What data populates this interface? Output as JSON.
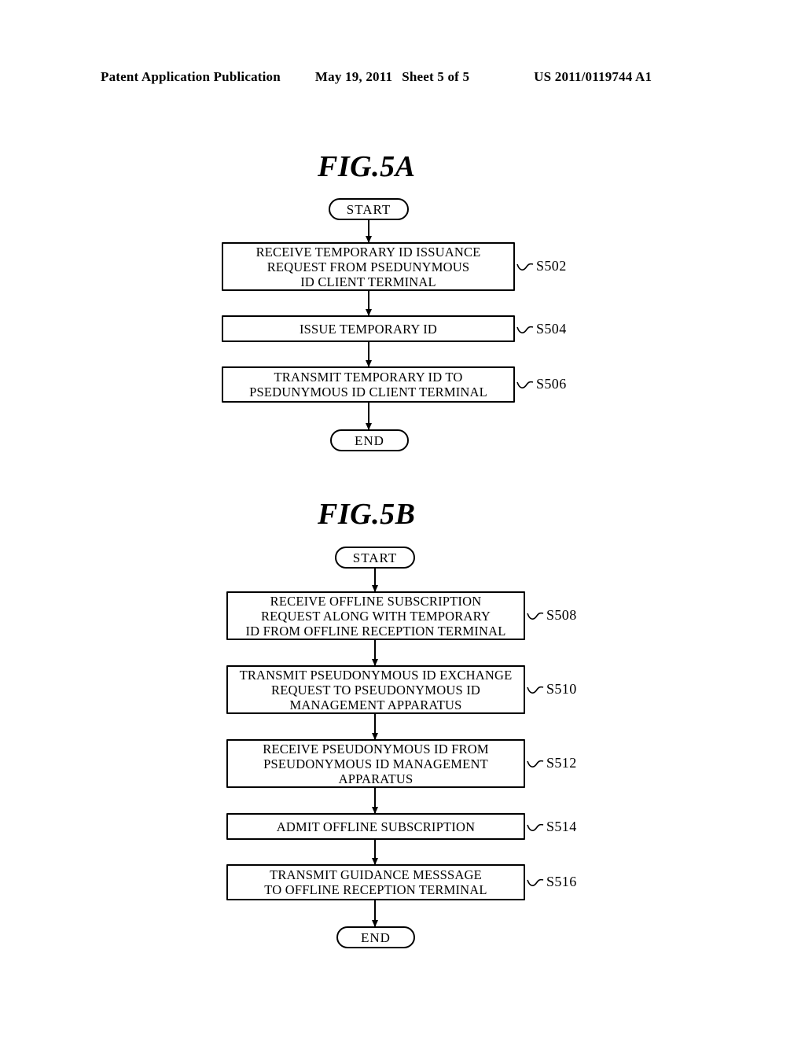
{
  "header": {
    "publication": "Patent Application Publication",
    "date": "May 19, 2011",
    "sheet": "Sheet 5 of 5",
    "publication_number": "US 2011/0119744 A1"
  },
  "figures": [
    {
      "title": "FIG.5A",
      "start_label": "START",
      "end_label": "END",
      "steps": [
        {
          "id": "S502",
          "lines": [
            "RECEIVE TEMPORARY ID ISSUANCE",
            "REQUEST FROM PSEDUNYMOUS",
            "ID CLIENT TERMINAL"
          ]
        },
        {
          "id": "S504",
          "lines": [
            "ISSUE TEMPORARY ID"
          ]
        },
        {
          "id": "S506",
          "lines": [
            "TRANSMIT TEMPORARY ID TO",
            "PSEDUNYMOUS ID CLIENT TERMINAL"
          ]
        }
      ]
    },
    {
      "title": "FIG.5B",
      "start_label": "START",
      "end_label": "END",
      "steps": [
        {
          "id": "S508",
          "lines": [
            "RECEIVE OFFLINE SUBSCRIPTION",
            "REQUEST ALONG WITH TEMPORARY",
            "ID FROM OFFLINE RECEPTION TERMINAL"
          ]
        },
        {
          "id": "S510",
          "lines": [
            "TRANSMIT PSEUDONYMOUS ID EXCHANGE",
            "REQUEST TO PSEUDONYMOUS ID",
            "MANAGEMENT APPARATUS"
          ]
        },
        {
          "id": "S512",
          "lines": [
            "RECEIVE PSEUDONYMOUS ID FROM",
            "PSEUDONYMOUS ID MANAGEMENT",
            "APPARATUS"
          ]
        },
        {
          "id": "S514",
          "lines": [
            "ADMIT OFFLINE SUBSCRIPTION"
          ]
        },
        {
          "id": "S516",
          "lines": [
            "TRANSMIT GUIDANCE MESSSAGE",
            "TO OFFLINE RECEPTION TERMINAL"
          ]
        }
      ]
    }
  ]
}
